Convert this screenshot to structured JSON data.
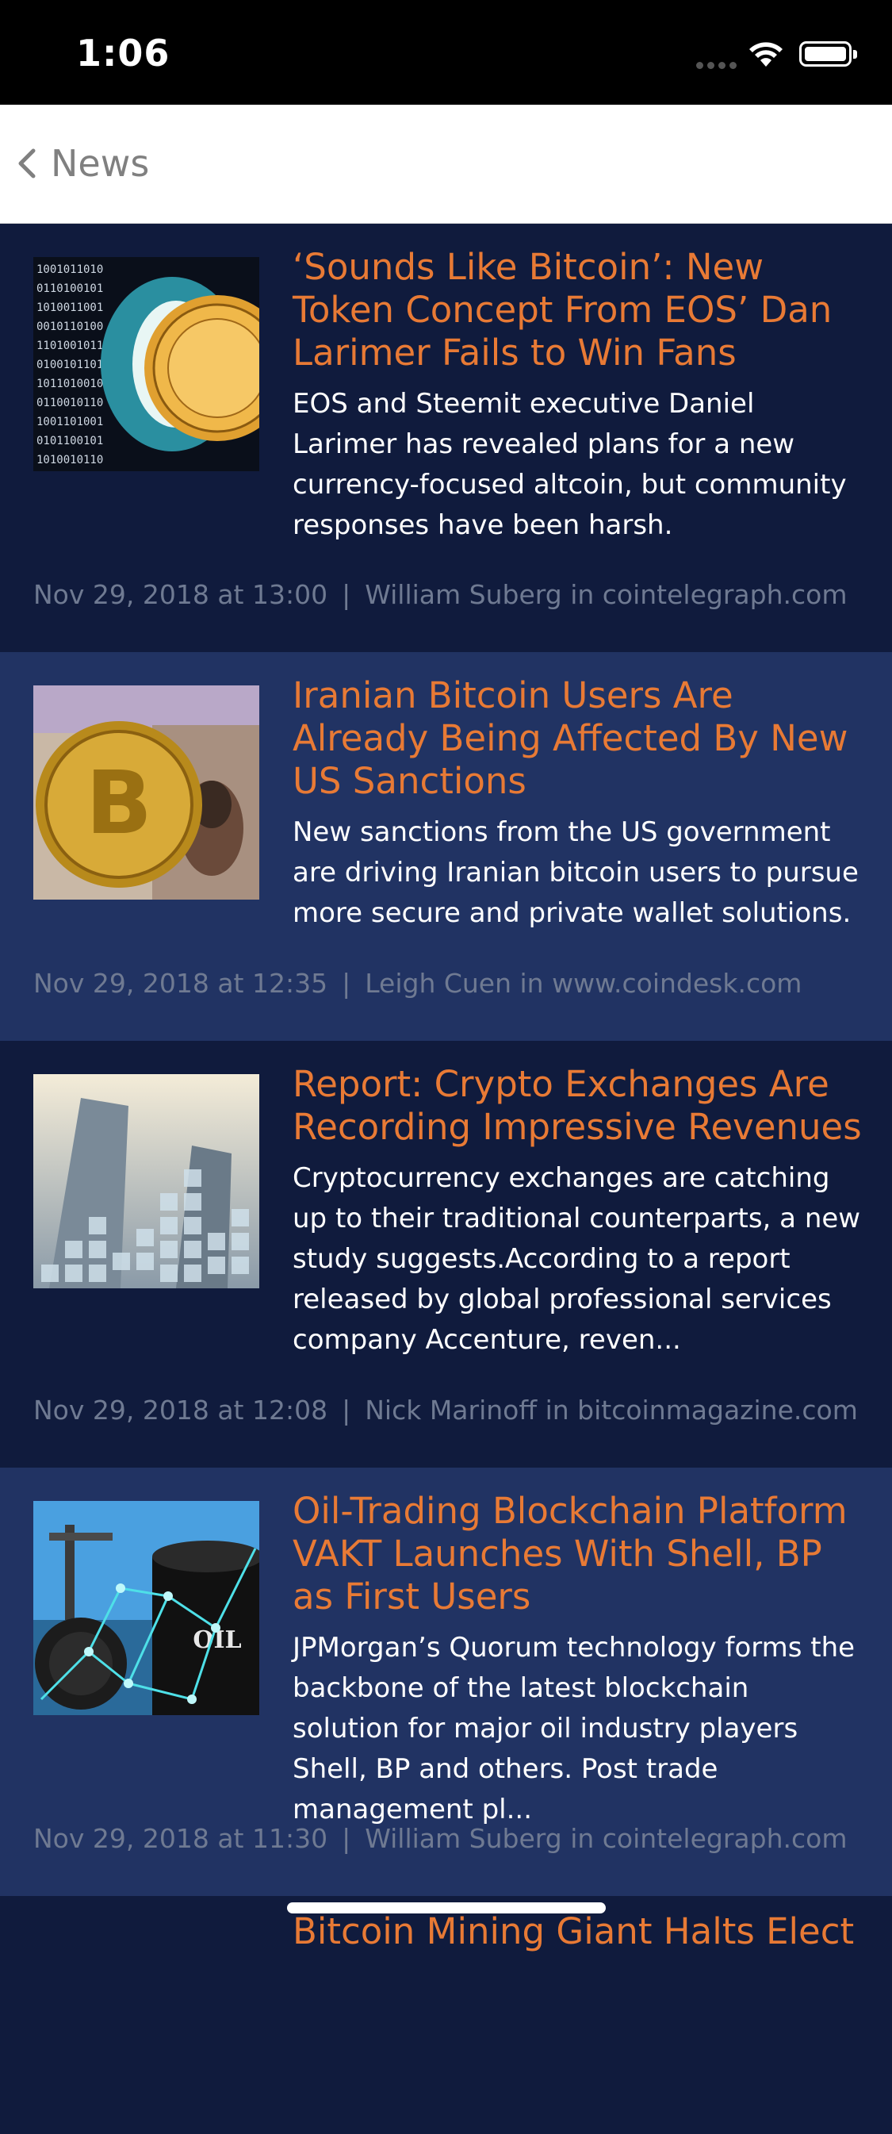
{
  "status_bar": {
    "time": "1:06"
  },
  "nav": {
    "back_label": "News"
  },
  "articles": [
    {
      "title": "‘Sounds Like Bitcoin’: New Token Concept From EOS’ Dan Larimer Fails to Win Fans",
      "summary": "EOS and Steemit executive Daniel Larimer has revealed plans for a new currency-focused altcoin, but community responses have been harsh.",
      "date": "Nov 29, 2018 at 13:00",
      "author_source": "William Suberg in cointelegraph.com",
      "thumbnail": "binary-tunnel-coin-image"
    },
    {
      "title": "Iranian Bitcoin Users Are Already Being Affected By New US Sanctions",
      "summary": "New sanctions from the US government are driving Iranian bitcoin users to pursue more secure and private wallet solutions.",
      "date": "Nov 29, 2018 at 12:35",
      "author_source": "Leigh Cuen in www.coindesk.com",
      "thumbnail": "bitcoin-on-banknote-image"
    },
    {
      "title": "Report: Crypto Exchanges Are Recording Impressive Revenues",
      "summary": "Cryptocurrency exchanges are catching up to their traditional counterparts, a new study suggests.According to a report released by global professional services company Accenture, reven...",
      "date": "Nov 29, 2018 at 12:08",
      "author_source": "Nick Marinoff in bitcoinmagazine.com",
      "thumbnail": "skyscrapers-bars-image"
    },
    {
      "title": "Oil-Trading Blockchain Platform VAKT Launches With Shell, BP as First Users",
      "summary": "JPMorgan’s Quorum technology forms the backbone of the latest blockchain solution for major oil industry players Shell, BP and others. Post trade management pl...",
      "date": "Nov 29, 2018 at 11:30",
      "author_source": "William Suberg in cointelegraph.com",
      "thumbnail": "oil-barrel-network-image",
      "barrel_text": "OIL"
    }
  ],
  "peek": {
    "title": "Bitcoin Mining Giant Halts Elect"
  },
  "colors": {
    "headline": "#e87a35",
    "dark_row": "#101b3d",
    "light_row": "#213363",
    "meta": "#6f7a92"
  }
}
